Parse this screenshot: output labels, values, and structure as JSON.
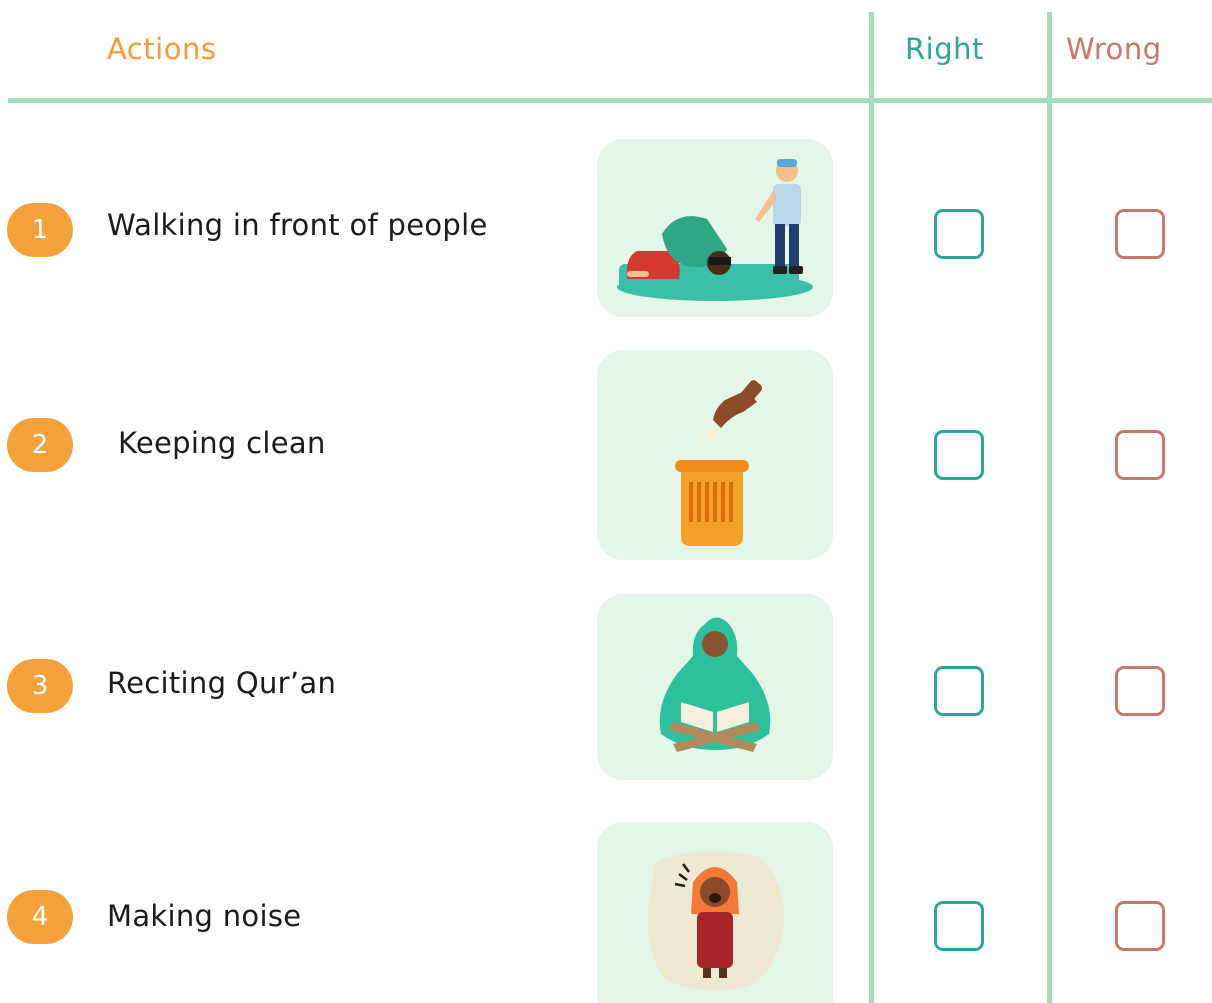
{
  "header": {
    "actions": "Actions",
    "right": "Right",
    "wrong": "Wrong"
  },
  "rows": [
    {
      "number": "1",
      "label": "Walking in front of people",
      "icon": "person-walking-in-front-of-praying-man-icon"
    },
    {
      "number": "2",
      "label": "Keeping clean",
      "icon": "hand-dropping-trash-in-bin-icon"
    },
    {
      "number": "3",
      "label": "Reciting Qur’an",
      "icon": "woman-reading-quran-icon"
    },
    {
      "number": "4",
      "label": "Making noise",
      "icon": "girl-shouting-icon"
    }
  ],
  "colors": {
    "header_actions": "#f39c3d",
    "header_right": "#2fa59a",
    "header_wrong": "#c8776b",
    "grid_line": "#a6dcbe",
    "number_badge": "#f6a23c",
    "tile_background": "#e4f6e8"
  },
  "checkboxes": {
    "right": [
      false,
      false,
      false,
      false
    ],
    "wrong": [
      false,
      false,
      false,
      false
    ]
  }
}
